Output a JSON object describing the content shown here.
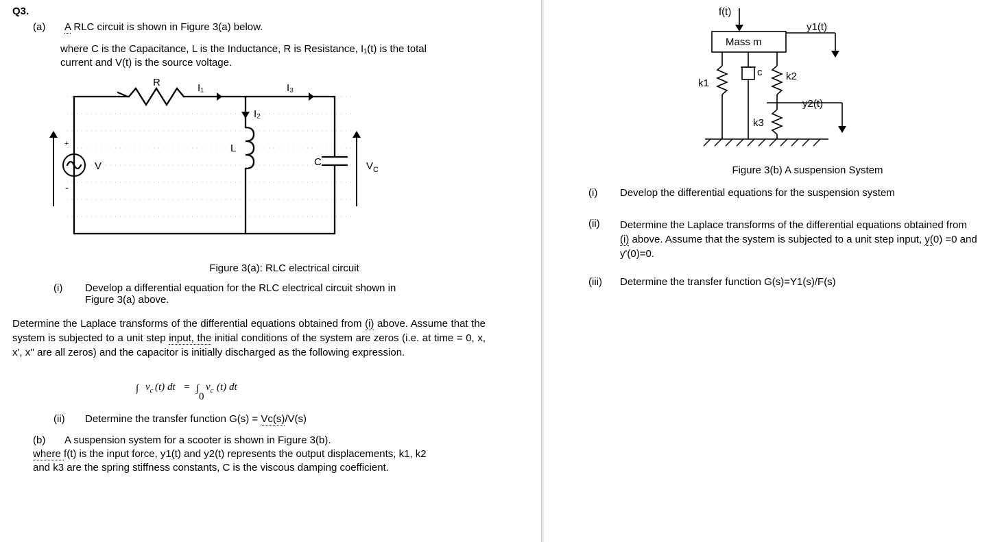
{
  "left": {
    "qnum": "Q3.",
    "a_label": "(a)",
    "a_text": "A RLC circuit is shown in Figure 3(a) below.",
    "a_underline_word": "A",
    "where_text": "where C is the Capacitance, L is the Inductance, R is Resistance, I₁(t) is the total current and V(t) is the source voltage.",
    "fig_a": {
      "R": "R",
      "I1": "I₁",
      "I2": "I₂",
      "I3": "I₃",
      "L": "L",
      "C": "C",
      "V": "V",
      "Vc": "V",
      "Vc_sub": "C",
      "plus": "+",
      "minus": "-"
    },
    "caption_a": "Figure 3(a): RLC electrical circuit",
    "i_label": "(i)",
    "i_text": "Develop a differential equation for the RLC electrical circuit shown in",
    "i_text2": "Figure 3(a) above.",
    "laplace_para_start": "Determine the Laplace transforms of the differential equations obtained from ",
    "laplace_para_i": "(i)",
    "laplace_para_cont1": " above. Assume that the system is subjected to a unit step ",
    "laplace_para_input": "input, the",
    "laplace_para_cont2": " initial conditions of the system are zeros (i.e. at time = 0, x, x', x'' are all zeros) and the capacitor is initially discharged as the following expression.",
    "eq": {
      "int": "∫",
      "v": "v",
      "c_sub": "c",
      "t": "(t)",
      "dt": "dt",
      "eq": "=",
      "zero": "0",
      "t_up": " "
    },
    "ii_label": "(ii)",
    "ii_text_pre": "Determine the transfer function G(s) = ",
    "ii_vc": "Vc(s)",
    "ii_text_post": "/V(s)",
    "b_label": "(b)",
    "b_text": "A suspension system for a scooter is shown in Figure 3(b).",
    "b_where_pre": "where ",
    "b_where_f": "f",
    "b_where_text": "(t) is the input force, y1(t) and y2(t) represents the output displacements, k1, k2 and k3 are the spring stiffness constants, C is the viscous damping coefficient."
  },
  "right": {
    "fig_b": {
      "ft": "f(t)",
      "mass": "Mass m",
      "y1": "y1(t)",
      "y2": "y2(t)",
      "k1": "k1",
      "k2": "k2",
      "k3": "k3",
      "c": "c"
    },
    "caption_b": "Figure 3(b) A suspension System",
    "i_label": "(i)",
    "i_text": "Develop the differential equations for the suspension system",
    "ii_label": "(ii)",
    "ii_text_pre": "Determine the Laplace transforms of the differential equations obtained from ",
    "ii_i": "(i)",
    "ii_text_cont": " above. Assume that the system is subjected to a unit step input, ",
    "ii_y0": "y(",
    "ii_text_cont2": "0) =0 and y'(0)=0.",
    "iii_label": "(iii)",
    "iii_text": "Determine the transfer function G(s)=Y1(s)/F(s)"
  }
}
